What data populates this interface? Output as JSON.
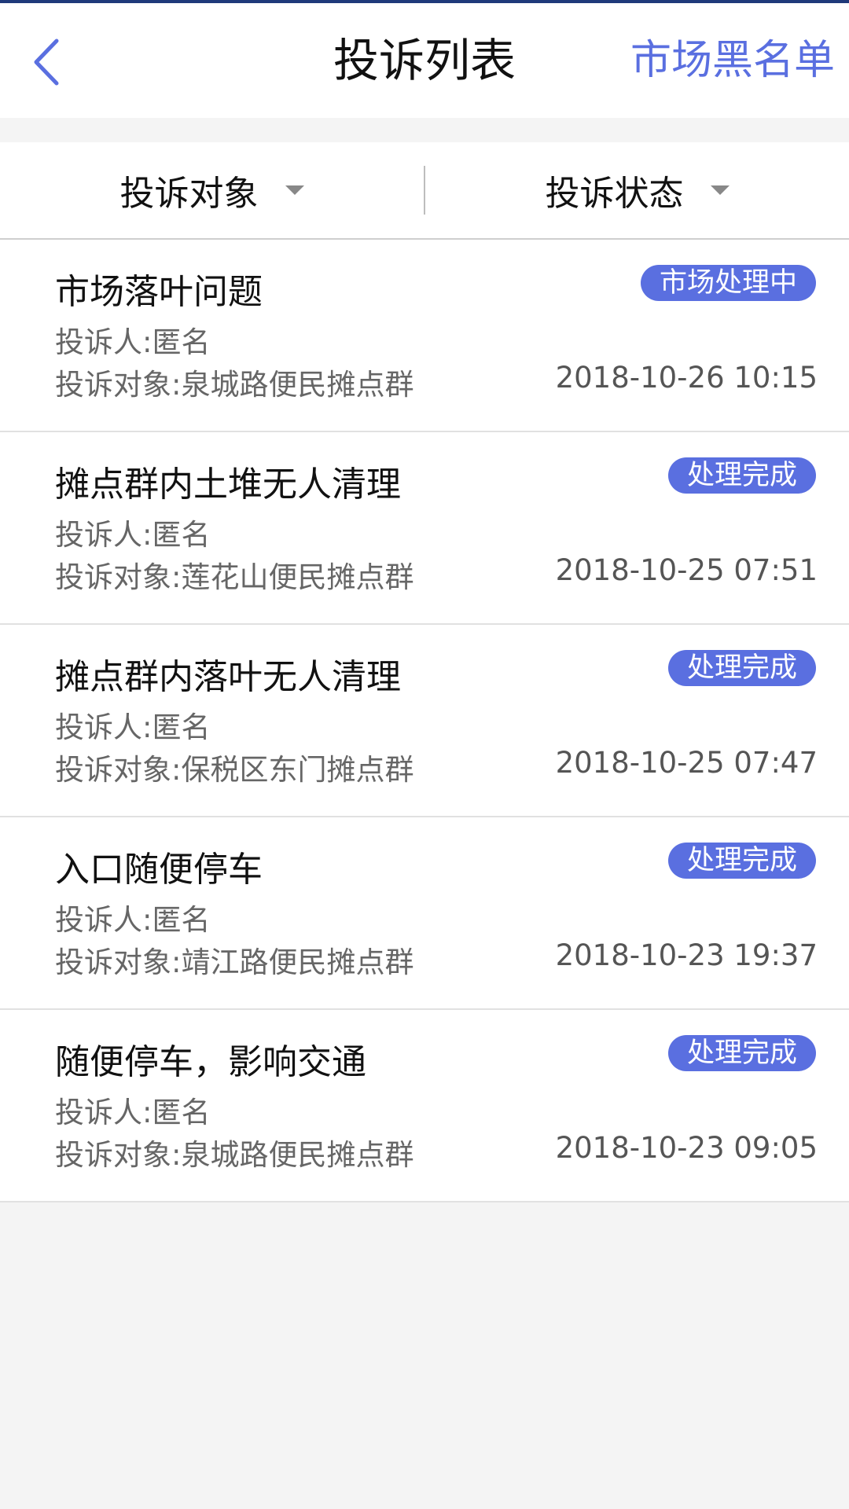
{
  "header": {
    "title": "投诉列表",
    "right_action": "市场黑名单"
  },
  "filters": {
    "target_label": "投诉对象",
    "status_label": "投诉状态"
  },
  "items": [
    {
      "title": "市场落叶问题",
      "status": "市场处理中",
      "complainant": "投诉人:匿名",
      "target": "投诉对象:泉城路便民摊点群",
      "time": "2018-10-26 10:15"
    },
    {
      "title": "摊点群内土堆无人清理",
      "status": "处理完成",
      "complainant": "投诉人:匿名",
      "target": "投诉对象:莲花山便民摊点群",
      "time": "2018-10-25 07:51"
    },
    {
      "title": "摊点群内落叶无人清理",
      "status": "处理完成",
      "complainant": "投诉人:匿名",
      "target": "投诉对象:保税区东门摊点群",
      "time": "2018-10-25 07:47"
    },
    {
      "title": "入口随便停车",
      "status": "处理完成",
      "complainant": "投诉人:匿名",
      "target": "投诉对象:靖江路便民摊点群",
      "time": "2018-10-23 19:37"
    },
    {
      "title": "随便停车，影响交通",
      "status": "处理完成",
      "complainant": "投诉人:匿名",
      "target": "投诉对象:泉城路便民摊点群",
      "time": "2018-10-23 09:05"
    }
  ],
  "colors": {
    "accent": "#5a6fe0",
    "top_line": "#1f3a7a",
    "background": "#f4f4f4"
  }
}
